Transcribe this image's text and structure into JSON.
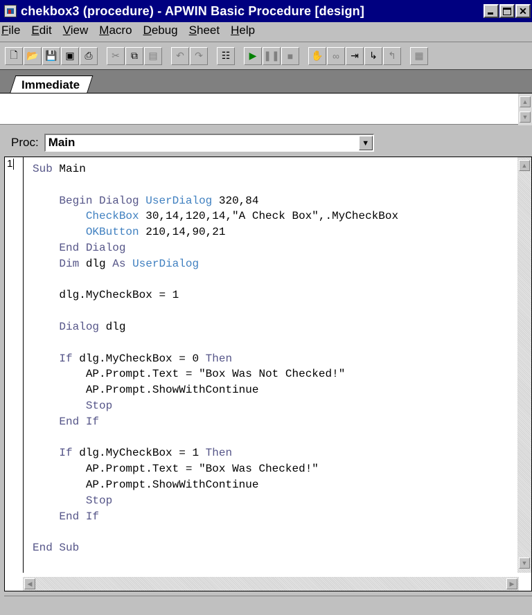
{
  "window": {
    "title": "chekbox3 (procedure) - APWIN Basic Procedure [design]"
  },
  "menu": [
    {
      "accel": "F",
      "rest": "ile"
    },
    {
      "accel": "E",
      "rest": "dit"
    },
    {
      "accel": "V",
      "rest": "iew"
    },
    {
      "accel": "M",
      "rest": "acro"
    },
    {
      "accel": "D",
      "rest": "ebug"
    },
    {
      "accel": "S",
      "rest": "heet"
    },
    {
      "accel": "H",
      "rest": "elp"
    }
  ],
  "toolbar": {
    "icons": [
      "new-icon",
      "open-icon",
      "save-icon",
      "save-all-icon",
      "print-icon",
      "cut-icon",
      "copy-icon",
      "paste-icon",
      "undo-icon",
      "redo-icon",
      "dialog-editor-icon",
      "run-icon",
      "pause-icon",
      "stop-icon",
      "toggle-breakpoint-icon",
      "quick-watch-icon",
      "step-into-icon",
      "step-over-icon",
      "step-out-icon",
      "calls-icon"
    ]
  },
  "tabs": {
    "immediate": "Immediate"
  },
  "proc": {
    "label": "Proc:",
    "value": "Main"
  },
  "editor": {
    "line_number": "1",
    "lines": [
      "Sub Main",
      "",
      "    Begin Dialog UserDialog 320,84",
      "        CheckBox 30,14,120,14,\"A Check Box\",.MyCheckBox",
      "        OKButton 210,14,90,21",
      "    End Dialog",
      "    Dim dlg As UserDialog",
      "",
      "    dlg.MyCheckBox = 1",
      "",
      "    Dialog dlg",
      "",
      "    If dlg.MyCheckBox = 0 Then",
      "        AP.Prompt.Text = \"Box Was Not Checked!\"",
      "        AP.Prompt.ShowWithContinue",
      "        Stop",
      "    End If",
      "",
      "    If dlg.MyCheckBox = 1 Then",
      "        AP.Prompt.Text = \"Box Was Checked!\"",
      "        AP.Prompt.ShowWithContinue",
      "        Stop",
      "    End If",
      "",
      "End Sub"
    ]
  },
  "colors": {
    "titlebar": "#000080",
    "keyword": "#555588",
    "function": "#4080c0"
  }
}
